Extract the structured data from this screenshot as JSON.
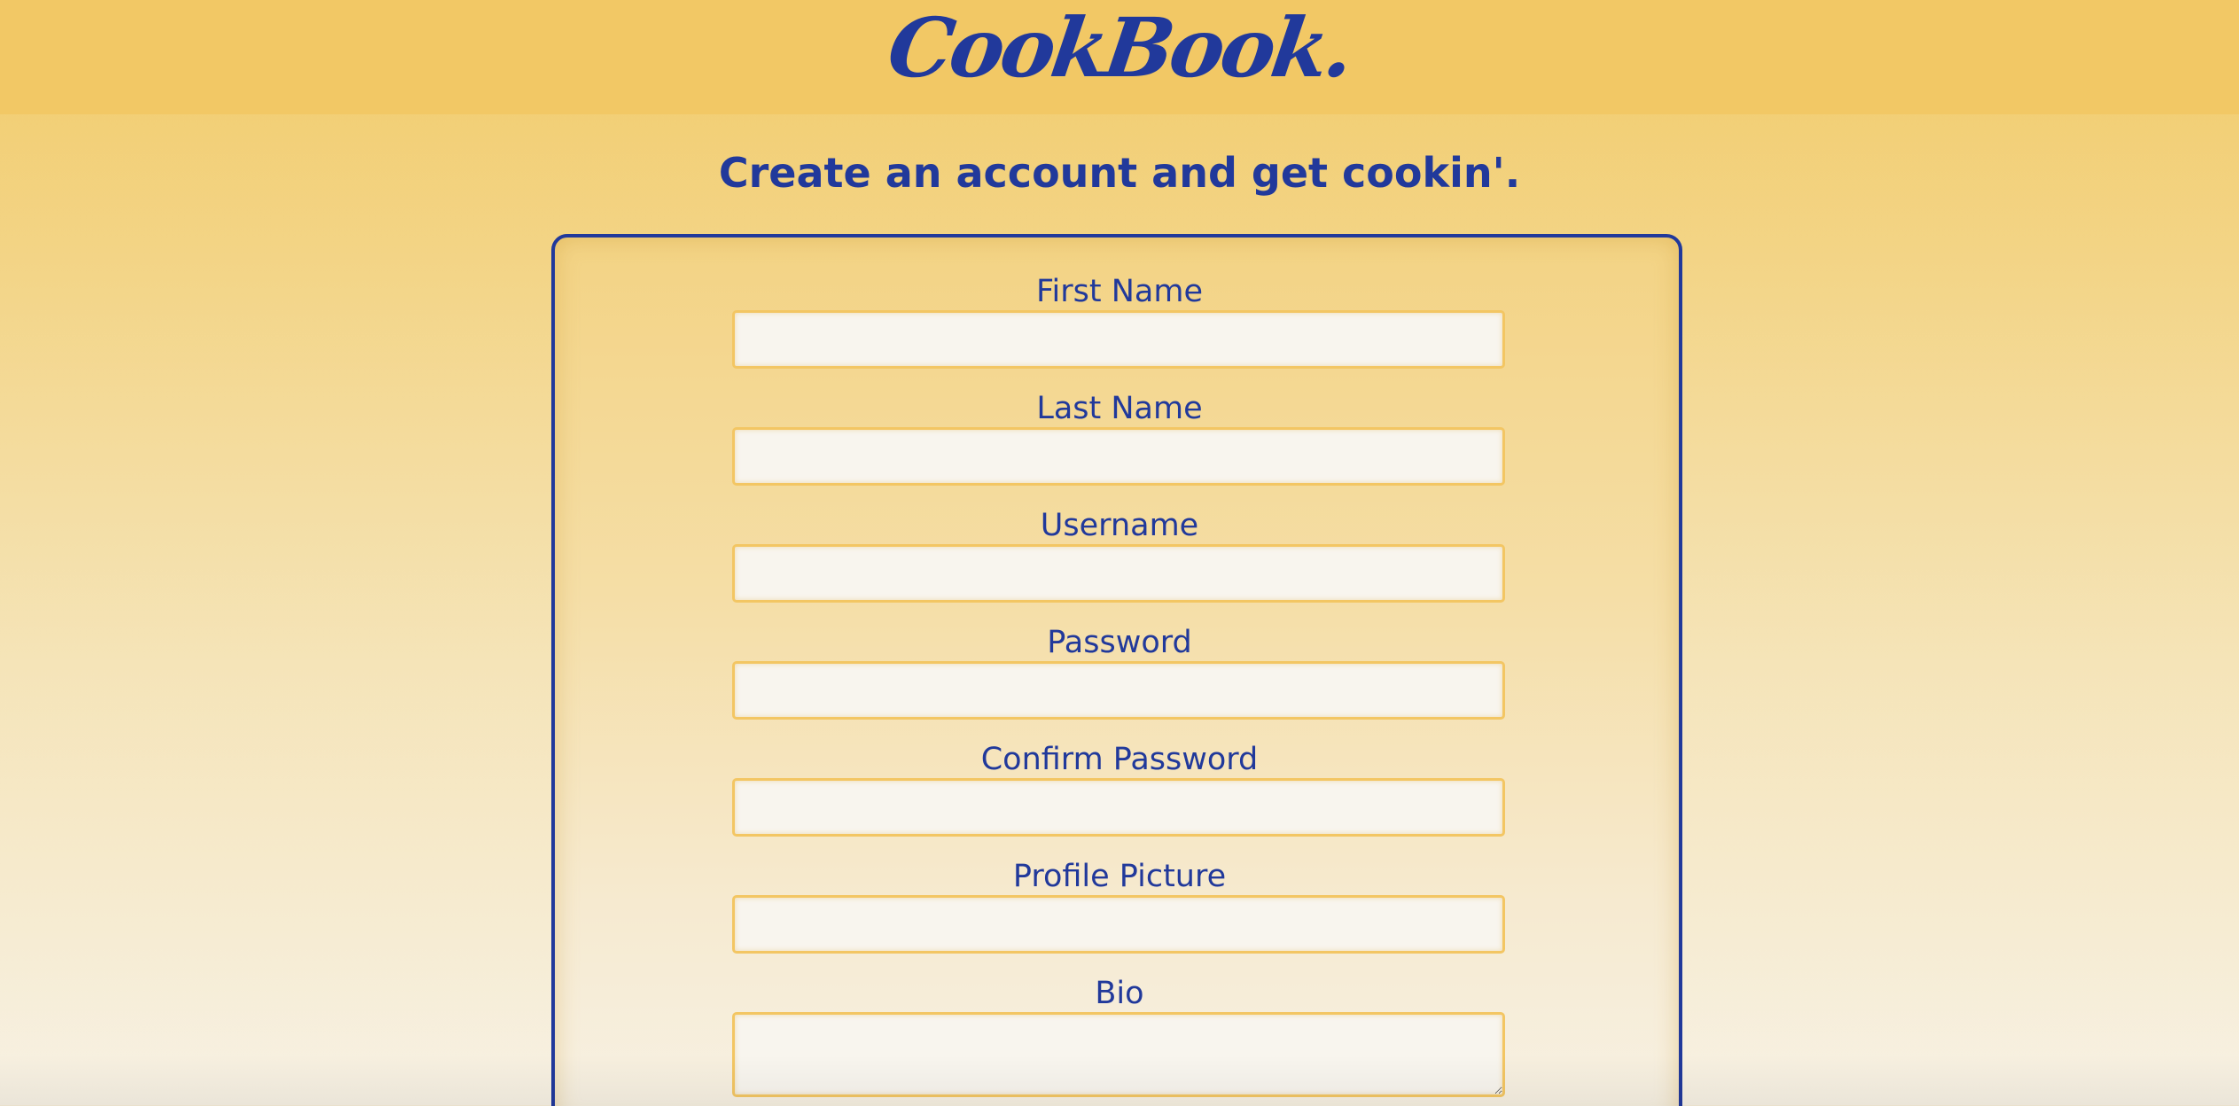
{
  "header": {
    "logo": "CookBook."
  },
  "page": {
    "subtitle": "Create an account and get cookin'."
  },
  "form": {
    "fields": [
      {
        "label": "First Name",
        "value": ""
      },
      {
        "label": "Last Name",
        "value": ""
      },
      {
        "label": "Username",
        "value": ""
      },
      {
        "label": "Password",
        "value": ""
      },
      {
        "label": "Confirm Password",
        "value": ""
      },
      {
        "label": "Profile Picture",
        "value": ""
      },
      {
        "label": "Bio",
        "value": ""
      }
    ]
  },
  "colors": {
    "brand": "#21399b",
    "header_background": "#f2c865",
    "input_border": "#f3c663",
    "input_background": "#f8f5ee"
  }
}
